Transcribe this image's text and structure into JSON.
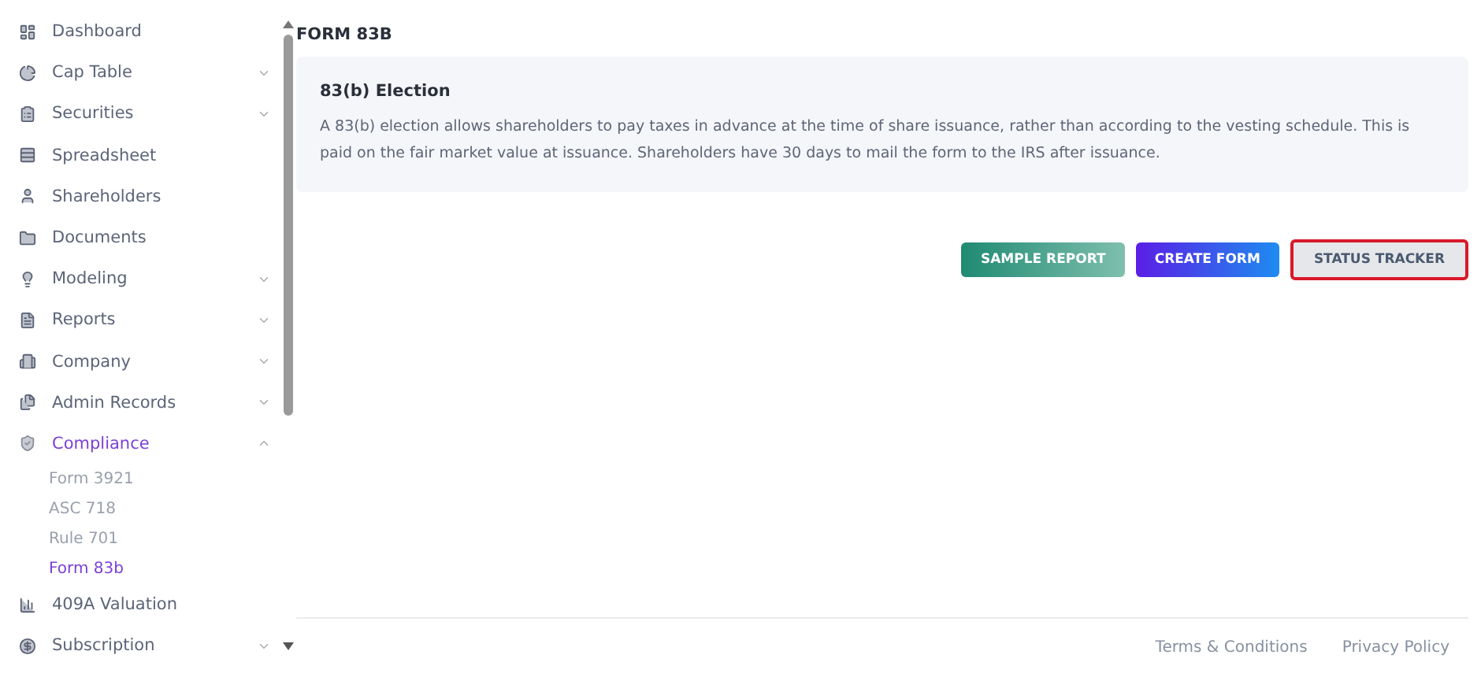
{
  "sidebar": {
    "items": [
      {
        "label": "Dashboard",
        "selected": false
      },
      {
        "label": "Cap Table",
        "expanded": false,
        "selected": false
      },
      {
        "label": "Securities",
        "expanded": false,
        "selected": false
      },
      {
        "label": "Spreadsheet",
        "selected": false
      },
      {
        "label": "Shareholders",
        "selected": false
      },
      {
        "label": "Documents",
        "selected": false
      },
      {
        "label": "Modeling",
        "expanded": false,
        "selected": false
      },
      {
        "label": "Reports",
        "expanded": false,
        "selected": false
      },
      {
        "label": "Company",
        "expanded": false,
        "selected": false
      },
      {
        "label": "Admin Records",
        "expanded": false,
        "selected": false
      },
      {
        "label": "Compliance",
        "expanded": true,
        "selected": true,
        "children": [
          {
            "label": "Form 3921",
            "selected": false
          },
          {
            "label": "ASC 718",
            "selected": false
          },
          {
            "label": "Rule 701",
            "selected": false
          },
          {
            "label": "Form 83b",
            "selected": true
          }
        ]
      },
      {
        "label": "409A Valuation",
        "selected": false
      },
      {
        "label": "Subscription",
        "expanded": false,
        "selected": false
      }
    ]
  },
  "page": {
    "title": "FORM 83B",
    "info": {
      "heading": "83(b) Election",
      "text": "A 83(b) election allows shareholders to pay taxes in advance at the time of share issuance, rather than according to the vesting schedule. This is paid on the fair market value at issuance. Shareholders have 30 days to mail the form to the IRS after issuance."
    },
    "buttons": [
      {
        "label": "SAMPLE REPORT",
        "kind": "teal",
        "outlined": false
      },
      {
        "label": "CREATE FORM",
        "kind": "violet",
        "outlined": false
      },
      {
        "label": "STATUS TRACKER",
        "kind": "grey",
        "outlined": true
      }
    ]
  },
  "footer": {
    "links": [
      "Terms & Conditions",
      "Privacy Policy"
    ]
  }
}
